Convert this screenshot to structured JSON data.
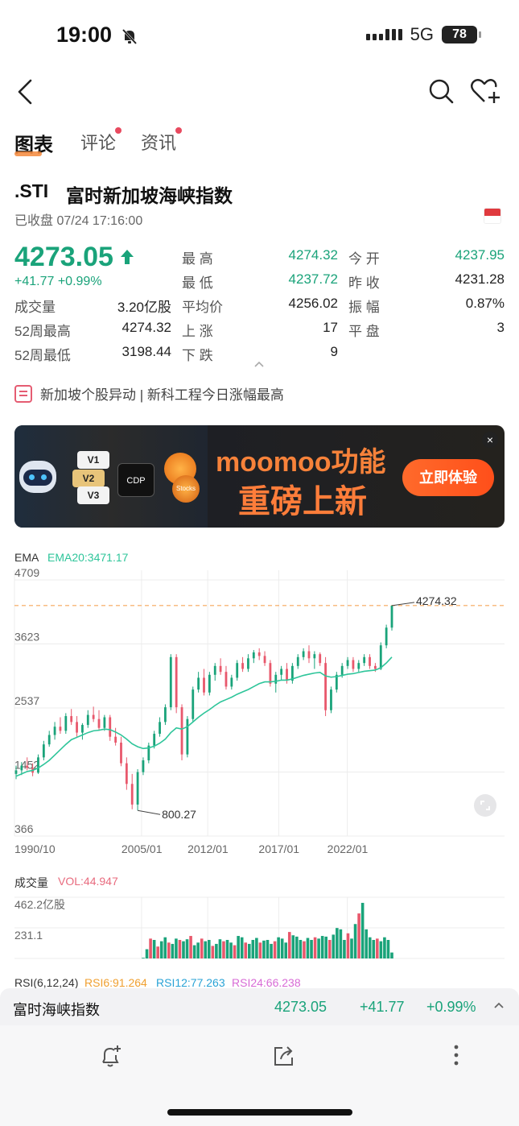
{
  "status": {
    "time": "19:00",
    "network": "5G",
    "battery": "78"
  },
  "tabs": [
    {
      "label": "图表",
      "active": true,
      "dot": false
    },
    {
      "label": "评论",
      "active": false,
      "dot": true
    },
    {
      "label": "资讯",
      "active": false,
      "dot": true
    }
  ],
  "quote": {
    "symbol": ".STI",
    "name": "富时新加坡海峡指数",
    "status": "已收盘 07/24 17:16:00",
    "price": "4273.05",
    "change": "+41.77 +0.99%",
    "up_color": "#1aa37a",
    "down_color": "#e8586c"
  },
  "stats": {
    "high_label": "最  高",
    "high": "4274.32",
    "open_label": "今  开",
    "open": "4237.95",
    "low_label": "最  低",
    "low": "4237.72",
    "prev_label": "昨  收",
    "prev": "4231.28",
    "volume_label": "成交量",
    "volume": "3.20亿股",
    "avg_label": "平均价",
    "avg": "4256.02",
    "amp_label": "振  幅",
    "amp": "0.87%",
    "w52h_label": "52周最高",
    "w52h": "4274.32",
    "rise_label": "上  涨",
    "rise": "17",
    "flat_label": "平  盘",
    "flat": "3",
    "w52l_label": "52周最低",
    "w52l": "3198.44",
    "fall_label": "下  跌",
    "fall": "9"
  },
  "news": {
    "text": "新加坡个股异动 | 新科工程今日涨幅最高"
  },
  "banner": {
    "title1": "moomoo功能",
    "title2": "重磅上新",
    "button": "立即体验",
    "cdp": "CDP",
    "v1": "V1",
    "v2": "V2",
    "v3": "V3",
    "stocks": "Stocks"
  },
  "ema": {
    "label": "EMA",
    "value": "EMA20:3471.17"
  },
  "chart_data": [
    {
      "type": "candlestick",
      "y_ticks": [
        "4709",
        "3623",
        "2537",
        "1452",
        "366"
      ],
      "ylim": [
        366,
        4709
      ],
      "x_ticks": [
        "1990/10",
        "2005/01",
        "2012/01",
        "2017/01",
        "2022/01"
      ],
      "annotations": {
        "max": "4274.32",
        "min": "800.27"
      },
      "reference_line": 4274.32,
      "series": [
        {
          "name": "candles",
          "ohlc": [
            [
              1420,
              1560,
              1330,
              1480
            ],
            [
              1480,
              1620,
              1400,
              1560
            ],
            [
              1560,
              1700,
              1480,
              1520
            ],
            [
              1520,
              1600,
              1380,
              1440
            ],
            [
              1440,
              1750,
              1420,
              1700
            ],
            [
              1700,
              1980,
              1650,
              1920
            ],
            [
              1920,
              2150,
              1880,
              2080
            ],
            [
              2080,
              2300,
              2000,
              2220
            ],
            [
              2220,
              2380,
              2100,
              2150
            ],
            [
              2150,
              2450,
              2100,
              2400
            ],
            [
              2400,
              2520,
              2250,
              2300
            ],
            [
              2300,
              2400,
              2050,
              2120
            ],
            [
              2120,
              2280,
              2000,
              2250
            ],
            [
              2250,
              2500,
              2200,
              2420
            ],
            [
              2420,
              2560,
              2300,
              2350
            ],
            [
              2350,
              2500,
              2150,
              2200
            ],
            [
              2200,
              2420,
              2150,
              2380
            ],
            [
              2380,
              2420,
              1980,
              2050
            ],
            [
              2050,
              2200,
              1900,
              1950
            ],
            [
              1950,
              2050,
              1550,
              1600
            ],
            [
              1600,
              1700,
              1150,
              1250
            ],
            [
              1250,
              1420,
              820,
              900
            ],
            [
              900,
              1500,
              800,
              1450
            ],
            [
              1450,
              1700,
              1400,
              1650
            ],
            [
              1650,
              1950,
              1600,
              1900
            ],
            [
              1900,
              2150,
              1850,
              2100
            ],
            [
              2100,
              2380,
              2050,
              2300
            ],
            [
              2300,
              2600,
              2250,
              2550
            ],
            [
              2550,
              3450,
              2500,
              3400
            ],
            [
              3400,
              3450,
              2450,
              2550
            ],
            [
              2550,
              2600,
              1650,
              1750
            ],
            [
              1750,
              2400,
              1700,
              2350
            ],
            [
              2350,
              2900,
              2300,
              2850
            ],
            [
              2850,
              3150,
              2800,
              3050
            ],
            [
              3050,
              3200,
              2750,
              2800
            ],
            [
              2800,
              3150,
              2750,
              3100
            ],
            [
              3100,
              3300,
              3000,
              3250
            ],
            [
              3250,
              3380,
              3100,
              3150
            ],
            [
              3150,
              3250,
              2850,
              2900
            ],
            [
              2900,
              3100,
              2850,
              3050
            ],
            [
              3050,
              3350,
              3000,
              3300
            ],
            [
              3300,
              3400,
              3150,
              3200
            ],
            [
              3200,
              3450,
              3150,
              3380
            ],
            [
              3380,
              3520,
              3300,
              3480
            ],
            [
              3480,
              3550,
              3350,
              3420
            ],
            [
              3420,
              3500,
              3250,
              3300
            ],
            [
              3300,
              3350,
              2900,
              2950
            ],
            [
              2950,
              3150,
              2800,
              3100
            ],
            [
              3100,
              3250,
              3000,
              3200
            ],
            [
              3200,
              3300,
              2950,
              3000
            ],
            [
              3000,
              3300,
              2950,
              3250
            ],
            [
              3250,
              3450,
              3200,
              3400
            ],
            [
              3400,
              3550,
              3350,
              3500
            ],
            [
              3500,
              3600,
              3300,
              3380
            ],
            [
              3380,
              3500,
              3200,
              3450
            ],
            [
              3450,
              3480,
              3250,
              3300
            ],
            [
              3300,
              3400,
              2400,
              2500
            ],
            [
              2500,
              2900,
              2450,
              2850
            ],
            [
              2850,
              3150,
              2800,
              3100
            ],
            [
              3100,
              3300,
              3050,
              3250
            ],
            [
              3250,
              3400,
              3200,
              3350
            ],
            [
              3350,
              3400,
              3150,
              3200
            ],
            [
              3200,
              3350,
              3150,
              3300
            ],
            [
              3300,
              3450,
              3250,
              3400
            ],
            [
              3400,
              3450,
              3200,
              3250
            ],
            [
              3250,
              3300,
              3150,
              3200
            ],
            [
              3200,
              3650,
              3180,
              3600
            ],
            [
              3600,
              3950,
              3550,
              3900
            ],
            [
              3900,
              4274,
              3850,
              4273
            ]
          ]
        },
        {
          "name": "EMA20",
          "values": [
            1380,
            1420,
            1460,
            1480,
            1520,
            1580,
            1650,
            1740,
            1830,
            1920,
            2000,
            2040,
            2080,
            2120,
            2150,
            2160,
            2180,
            2170,
            2130,
            2080,
            2010,
            1930,
            1880,
            1850,
            1860,
            1890,
            1940,
            2010,
            2120,
            2200,
            2180,
            2220,
            2300,
            2380,
            2450,
            2510,
            2580,
            2640,
            2680,
            2720,
            2770,
            2810,
            2850,
            2900,
            2950,
            2980,
            2980,
            2990,
            3010,
            3010,
            3030,
            3060,
            3090,
            3110,
            3130,
            3140,
            3080,
            3060,
            3070,
            3090,
            3110,
            3120,
            3140,
            3160,
            3170,
            3180,
            3220,
            3300,
            3400
          ]
        }
      ]
    },
    {
      "type": "bar",
      "title": "成交量",
      "label": "VOL:44.947",
      "y_ticks": [
        "462.2亿股",
        "231.1"
      ],
      "ylim": [
        0,
        462.2
      ],
      "values": [
        5,
        70,
        150,
        140,
        90,
        130,
        160,
        120,
        110,
        150,
        140,
        130,
        145,
        170,
        100,
        120,
        150,
        130,
        140,
        95,
        110,
        145,
        130,
        140,
        120,
        100,
        170,
        160,
        120,
        110,
        140,
        155,
        120,
        135,
        140,
        110,
        130,
        160,
        150,
        120,
        200,
        175,
        165,
        140,
        130,
        155,
        140,
        160,
        150,
        170,
        165,
        140,
        180,
        230,
        220,
        140,
        190,
        150,
        260,
        340,
        420,
        220,
        160,
        140,
        150,
        130,
        160,
        140,
        45
      ],
      "up": [
        true,
        true,
        false,
        true,
        false,
        true,
        true,
        false,
        true,
        true,
        false,
        true,
        true,
        false,
        true,
        true,
        false,
        true,
        true,
        false,
        true,
        true,
        false,
        true,
        true,
        false,
        true,
        true,
        false,
        true,
        true,
        true,
        false,
        true,
        true,
        true,
        false,
        true,
        true,
        true,
        false,
        true,
        true,
        true,
        false,
        true,
        true,
        false,
        true,
        true,
        true,
        false,
        true,
        true,
        true,
        true,
        false,
        true,
        true,
        false,
        true,
        true,
        true,
        true,
        false,
        true,
        true,
        true,
        true
      ]
    }
  ],
  "volume": {
    "label": "成交量",
    "value": "VOL:44.947"
  },
  "rsi": {
    "label": "RSI(6,12,24)",
    "rsi6": "RSI6:91.264",
    "rsi12": "RSI12:77.263",
    "rsi24": "RSI24:66.238"
  },
  "bottom": {
    "name": "富时海峡指数",
    "price": "4273.05",
    "change": "+41.77",
    "pct": "+0.99%"
  }
}
